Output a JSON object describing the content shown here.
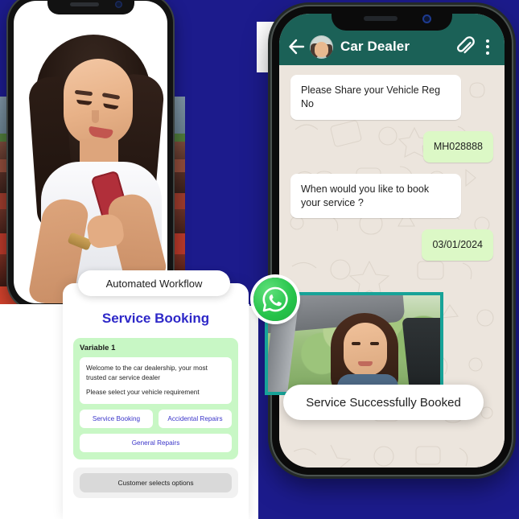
{
  "theme": {
    "navy": "#1c1b8c",
    "whatsapp_header_green": "#1b6157",
    "whatsapp_logo_green": "#25c34a",
    "chat_bg": "#ece5dd",
    "out_bubble_green": "#dcf8c6",
    "card_accent_blue": "#2e28c8",
    "workflow_green": "#c8f7c5",
    "image_border_teal": "#17a398"
  },
  "whatsapp": {
    "header": {
      "back_icon": "arrow-left-icon",
      "avatar_alt": "car-dealer-avatar",
      "title": "Car Dealer",
      "attach_icon": "paperclip-icon",
      "menu_icon": "kebab-menu-icon"
    },
    "messages": [
      {
        "direction": "in",
        "text": "Please Share your Vehicle Reg No"
      },
      {
        "direction": "out",
        "text": "MH028888"
      },
      {
        "direction": "in",
        "text": "When would you like to book your service ?"
      },
      {
        "direction": "out",
        "text": "03/01/2024"
      }
    ],
    "image_attachment_alt": "woman-in-car-photo",
    "logo_badge": "whatsapp-logo-icon",
    "success_banner": "Service Successfully Booked"
  },
  "workflow": {
    "pill_label": "Automated Workflow",
    "title": "Service Booking",
    "variable_label": "Variable 1",
    "message_lines": [
      "Welcome to the car dealership, your most trusted car service dealer",
      "Please select your vehicle requirement"
    ],
    "options": [
      "Service Booking",
      "Accidental Repairs",
      "General Repairs"
    ],
    "footer_action": "Customer selects options"
  },
  "left_phone": {
    "screen_alt": "woman-using-smartphone-photo"
  }
}
